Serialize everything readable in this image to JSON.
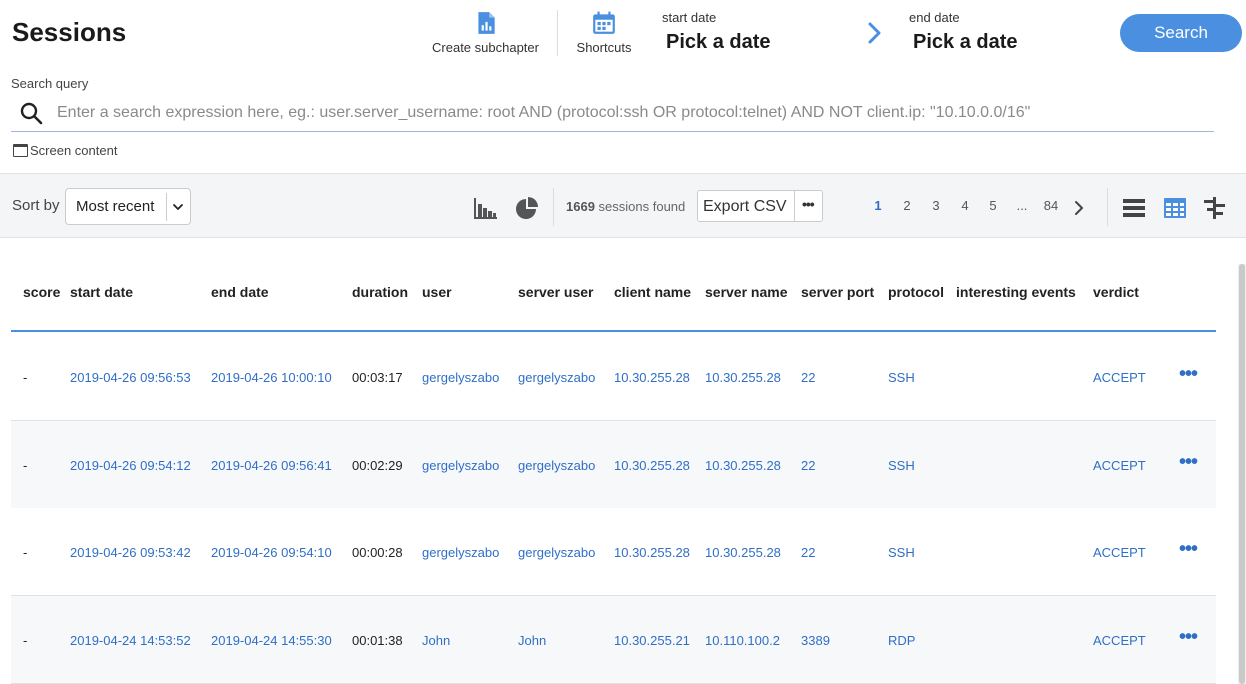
{
  "header": {
    "title": "Sessions",
    "create_subchapter_label": "Create subchapter",
    "shortcuts_label": "Shortcuts",
    "start_date_label": "start date",
    "start_date_value": "Pick a date",
    "end_date_label": "end date",
    "end_date_value": "Pick a date",
    "search_button": "Search"
  },
  "search": {
    "label": "Search query",
    "value": "",
    "placeholder": "Enter a search expression here, eg.: user.server_username: root AND (protocol:ssh OR protocol:telnet) AND NOT client.ip: \"10.10.0.0/16\"",
    "screen_content_label": "Screen content"
  },
  "toolbar": {
    "sort_by_label": "Sort by",
    "sort_value": "Most recent",
    "sessions_count": "1669",
    "sessions_found_text": "sessions found",
    "export_label": "Export CSV",
    "export_more": "•••",
    "pages": [
      "1",
      "2",
      "3",
      "4",
      "5",
      "...",
      "84"
    ],
    "active_page": "1"
  },
  "table": {
    "columns": {
      "score": "score",
      "start_date": "start date",
      "end_date": "end date",
      "duration": "duration",
      "user": "user",
      "server_user": "server user",
      "client_name": "client name",
      "server_name": "server name",
      "server_port": "server port",
      "protocol": "protocol",
      "interesting_events": "interesting events",
      "verdict": "verdict"
    },
    "rows": [
      {
        "score": "-",
        "start_date": "2019-04-26 09:56:53",
        "end_date": "2019-04-26 10:00:10",
        "duration": "00:03:17",
        "user": "gergelyszabo",
        "server_user": "gergelyszabo",
        "client_name": "10.30.255.28",
        "server_name": "10.30.255.28",
        "server_port": "22",
        "protocol": "SSH",
        "interesting_events": "",
        "verdict": "ACCEPT"
      },
      {
        "score": "-",
        "start_date": "2019-04-26 09:54:12",
        "end_date": "2019-04-26 09:56:41",
        "duration": "00:02:29",
        "user": "gergelyszabo",
        "server_user": "gergelyszabo",
        "client_name": "10.30.255.28",
        "server_name": "10.30.255.28",
        "server_port": "22",
        "protocol": "SSH",
        "interesting_events": "",
        "verdict": "ACCEPT"
      },
      {
        "score": "-",
        "start_date": "2019-04-26 09:53:42",
        "end_date": "2019-04-26 09:54:10",
        "duration": "00:00:28",
        "user": "gergelyszabo",
        "server_user": "gergelyszabo",
        "client_name": "10.30.255.28",
        "server_name": "10.30.255.28",
        "server_port": "22",
        "protocol": "SSH",
        "interesting_events": "",
        "verdict": "ACCEPT"
      },
      {
        "score": "-",
        "start_date": "2019-04-24 14:53:52",
        "end_date": "2019-04-24 14:55:30",
        "duration": "00:01:38",
        "user": "John",
        "server_user": "John",
        "client_name": "10.30.255.21",
        "server_name": "10.110.100.2",
        "server_port": "3389",
        "protocol": "RDP",
        "interesting_events": "",
        "verdict": "ACCEPT"
      }
    ],
    "row_more": "•••"
  },
  "icons": {
    "subchapter": "document-chart-icon",
    "shortcuts": "calendar-icon",
    "date_arrow": "chevron-right-icon",
    "search": "search-icon",
    "screen": "window-icon",
    "sort_chevron": "chevron-down-icon",
    "bar_chart": "bar-chart-icon",
    "pie_chart": "pie-chart-icon",
    "next_page": "chevron-right-icon",
    "list_view": "list-view-icon",
    "grid_view": "grid-view-icon",
    "tree_view": "tree-view-icon"
  },
  "colors": {
    "accent": "#4a8fe0",
    "link": "#2f6fc6",
    "toolbar_bg": "#f4f5f7"
  }
}
